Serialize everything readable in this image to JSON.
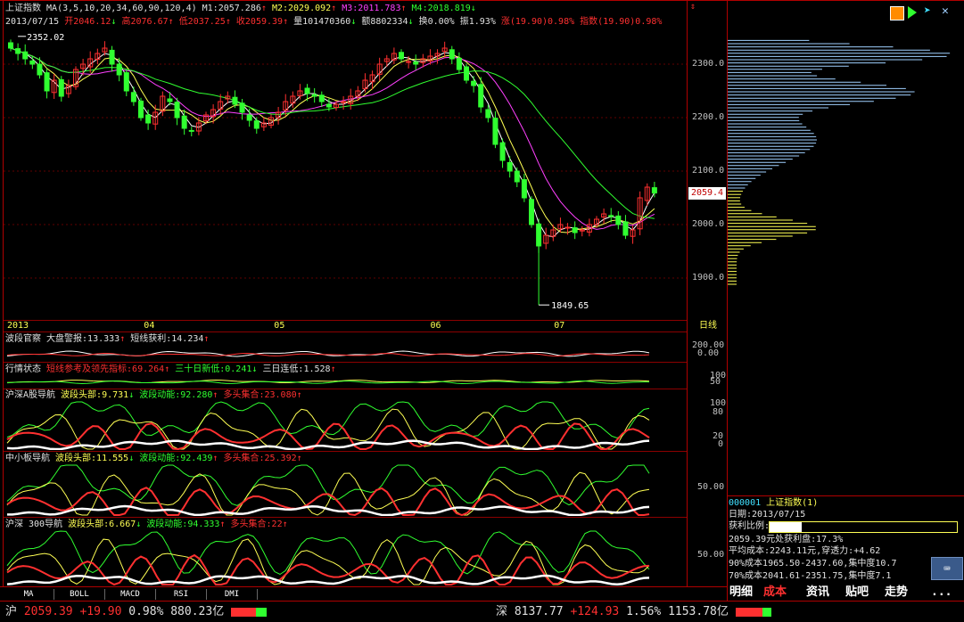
{
  "header": {
    "index_name": "上证指数",
    "ma_label": "MA(3,5,10,20,34,60,90,120,4)",
    "m1": "M1:2057.286",
    "m2": "M2:2029.092",
    "m3": "M3:2011.783",
    "m4": "M4:2018.819",
    "date": "2013/07/15",
    "open": "开2046.12",
    "high": "高2076.67",
    "low": "低2037.25",
    "close": "收2059.39",
    "volume": "量101470360",
    "amount": "额8802334",
    "turnover": "换0.00%",
    "amplitude": "振1.93%",
    "change": "涨(19.90)0.98%",
    "index_change": "指数(19.90)0.98%"
  },
  "chart_data": {
    "type": "candlestick",
    "high_label": "2352.02",
    "low_label": "1849.65",
    "current_price_label": "2059.4",
    "y_ticks": [
      "2300.0",
      "2200.0",
      "2100.0",
      "2000.0",
      "1900.0"
    ],
    "x_labels": [
      "2013",
      "04",
      "05",
      "06",
      "07"
    ],
    "period_label": "日线",
    "close": [
      2330,
      2320,
      2310,
      2300,
      2280,
      2250,
      2270,
      2240,
      2260,
      2290,
      2300,
      2310,
      2320,
      2330,
      2300,
      2280,
      2250,
      2230,
      2200,
      2190,
      2210,
      2240,
      2230,
      2200,
      2180,
      2175,
      2190,
      2205,
      2215,
      2230,
      2240,
      2225,
      2210,
      2195,
      2180,
      2190,
      2200,
      2210,
      2230,
      2240,
      2250,
      2245,
      2240,
      2230,
      2220,
      2225,
      2230,
      2240,
      2250,
      2270,
      2280,
      2300,
      2310,
      2320,
      2310,
      2305,
      2300,
      2310,
      2315,
      2320,
      2330,
      2310,
      2290,
      2270,
      2260,
      2220,
      2200,
      2150,
      2120,
      2100,
      2080,
      2050,
      2000,
      1960,
      1980,
      1990,
      2000,
      1995,
      1985,
      1990,
      2000,
      2010,
      2020,
      2015,
      2000,
      1980,
      1990,
      2050,
      2070,
      2059
    ]
  },
  "indicators": {
    "p1": {
      "name": "波段官察",
      "a": "大盘警报:13.333",
      "b": "短线获利:14.234",
      "ticks": [
        "200.00",
        "0.00"
      ]
    },
    "p2": {
      "name": "行情状态",
      "a": "短线参考及领先指标:69.264",
      "b": "三十日新低:0.241",
      "c": "三日连低:1.528",
      "ticks": [
        "100",
        "50"
      ]
    },
    "p3": {
      "name": "沪深A股导航",
      "a": "波段头部:9.731",
      "b": "波段动能:92.280",
      "c": "多头集合:23.080",
      "ticks": [
        "100",
        "80",
        "20",
        "0"
      ]
    },
    "p4": {
      "name": "中小板导航",
      "a": "波段头部:11.555",
      "b": "波段动能:92.439",
      "c": "多头集合:25.392",
      "ticks": [
        "50.00"
      ]
    },
    "p5": {
      "name": "沪深 300导航",
      "a": "波段头部:6.667",
      "b": "波段动能:94.333",
      "c": "多头集合:22",
      "ticks": [
        "50.00"
      ]
    }
  },
  "bottom_tabs": [
    "MA",
    "BOLL",
    "MACD",
    "RSI",
    "DMI"
  ],
  "right_panel": {
    "code": "000001",
    "name": "上证指数(1)",
    "date_label": "日期:2013/07/15",
    "profit_label": "获利比例:",
    "profit_value": "17.3%",
    "line1": "2059.39元处获利盘:17.3%",
    "line2": "平均成本:2243.11元,穿透力:+4.62",
    "line3": "90%成本1965.50-2437.60,集中度10.7",
    "line4": "70%成本2041.61-2351.75,集中度7.1",
    "tabs": [
      "明细",
      "成本",
      "资讯",
      "贴吧",
      "走势"
    ],
    "more": "..."
  },
  "status_bar": {
    "sh_label": "沪",
    "sh_value": "2059.39",
    "sh_change": "+19.90",
    "sh_pct": "0.98%",
    "sh_amount": "880.23亿",
    "sz_label": "深",
    "sz_value": "8137.77",
    "sz_change": "+124.93",
    "sz_pct": "1.56%",
    "sz_amount": "1153.78亿"
  },
  "colors": {
    "up": "#ff3030",
    "down": "#30ff30",
    "ma1": "#ffffff",
    "ma2": "#ffff54",
    "ma3": "#ff40ff",
    "ma4": "#30ff30",
    "frame": "#b00000"
  }
}
